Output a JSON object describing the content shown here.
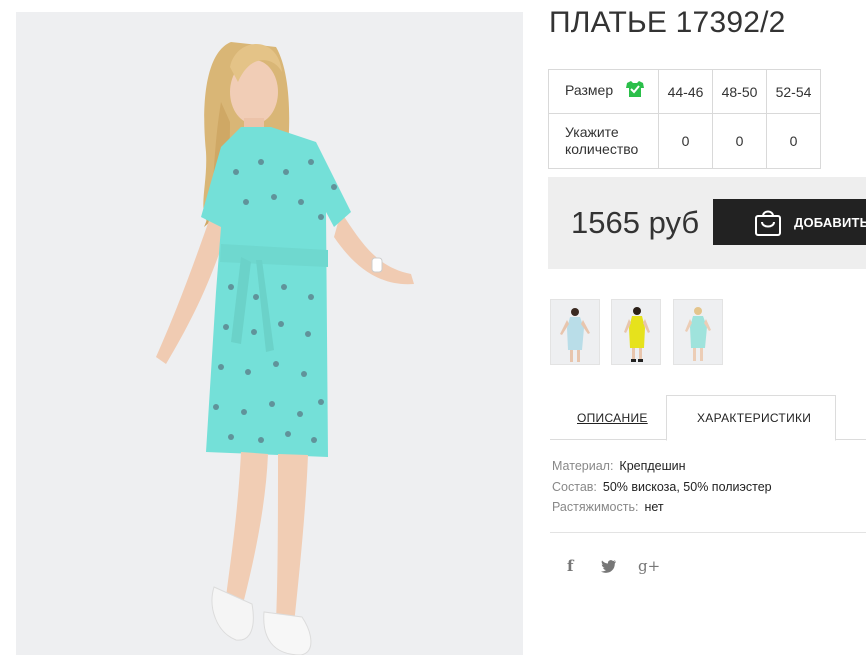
{
  "product": {
    "title": "ПЛАТЬЕ 17392/2",
    "price": "1565 руб"
  },
  "size_table": {
    "size_label": "Размер",
    "qty_label": "Укажите количество",
    "sizes": [
      "44-46",
      "48-50",
      "52-54"
    ],
    "quantities": [
      "0",
      "0",
      "0"
    ]
  },
  "cart": {
    "add_label": "ДОБАВИТЬ"
  },
  "thumbnails": [
    {
      "name": "thumb-dress-blue",
      "color": "#b9dde8"
    },
    {
      "name": "thumb-dress-yellow",
      "color": "#e6e21c"
    },
    {
      "name": "thumb-dress-mint",
      "color": "#9fe3dc"
    }
  ],
  "tabs": {
    "description": "ОПИСАНИЕ",
    "characteristics": "ХАРАКТЕРИСТИКИ",
    "active": "characteristics"
  },
  "characteristics": [
    {
      "key": "Материал:",
      "value": "Крепдешин"
    },
    {
      "key": "Состав:",
      "value": "50% вискоза, 50% полиэстер"
    },
    {
      "key": "Растяжимость:",
      "value": "нет"
    }
  ],
  "social": {
    "facebook_glyph": "f",
    "twitter_glyph": "🐦",
    "googleplus_glyph": "g+"
  },
  "colors": {
    "accent_check": "#2bbf4a",
    "button_bg": "#222222",
    "dress": "#74e0d8"
  }
}
